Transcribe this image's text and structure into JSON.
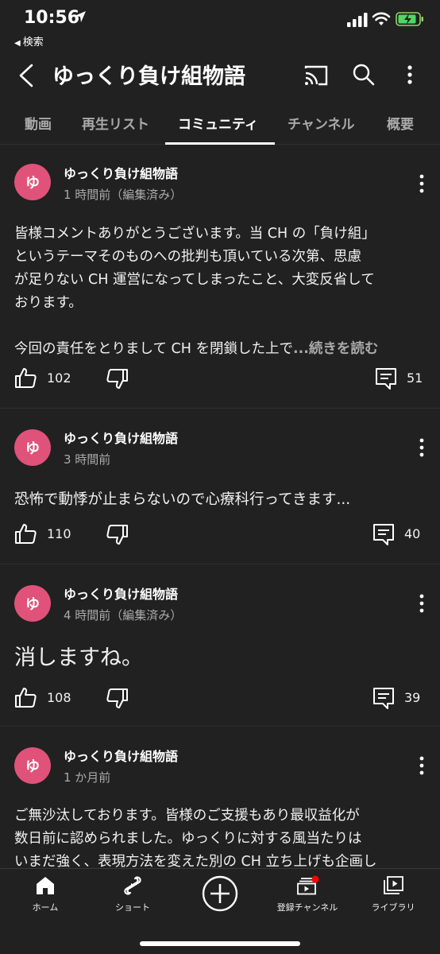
{
  "status": {
    "time": "10:56",
    "back_app": "検索"
  },
  "header": {
    "title": "ゆっくり負け組物語"
  },
  "tabs": [
    {
      "label": "動画"
    },
    {
      "label": "再生リスト"
    },
    {
      "label": "コミュニティ"
    },
    {
      "label": "チャンネル"
    },
    {
      "label": "概要"
    }
  ],
  "posts": [
    {
      "avatar": "ゆ",
      "author": "ゆっくり負け組物語",
      "time": "1 時間前（編集済み）",
      "lines": [
        "皆様コメントありがとうございます。当 CH の「負け組」",
        "というテーマそのものへの批判も頂いている次第、思慮",
        "が足りない CH 運営になってしまったこと、大変反省して",
        "おります。",
        "今回の責任をとりまして CH を閉鎖した上で"
      ],
      "read_more": "...続きを読む",
      "likes": "102",
      "comments": "51"
    },
    {
      "avatar": "ゆ",
      "author": "ゆっくり負け組物語",
      "time": "3 時間前",
      "lines": [
        "恐怖で動悸が止まらないので心療科行ってきます..."
      ],
      "likes": "110",
      "comments": "40"
    },
    {
      "avatar": "ゆ",
      "author": "ゆっくり負け組物語",
      "time": "4 時間前（編集済み）",
      "lines": [
        "消しますね。"
      ],
      "likes": "108",
      "comments": "39"
    },
    {
      "avatar": "ゆ",
      "author": "ゆっくり負け組物語",
      "time": "1 か月前",
      "lines": [
        "ご無沙汰しております。皆様のご支援もあり最収益化が",
        "数日前に認められました。ゆっくりに対する風当たりは",
        "いまだ強く、表現方法を変えた別の CH 立ち上げも企画し"
      ]
    }
  ],
  "nav": [
    {
      "label": "ホーム",
      "icon": "home-icon"
    },
    {
      "label": "ショート",
      "icon": "shorts-icon"
    },
    {
      "label": "",
      "icon": "create-icon"
    },
    {
      "label": "登録チャンネル",
      "icon": "subscriptions-icon"
    },
    {
      "label": "ライブラリ",
      "icon": "library-icon"
    }
  ],
  "colors": {
    "background": "#212121",
    "avatar": "#e0527a",
    "notification_dot": "#ff0000"
  }
}
